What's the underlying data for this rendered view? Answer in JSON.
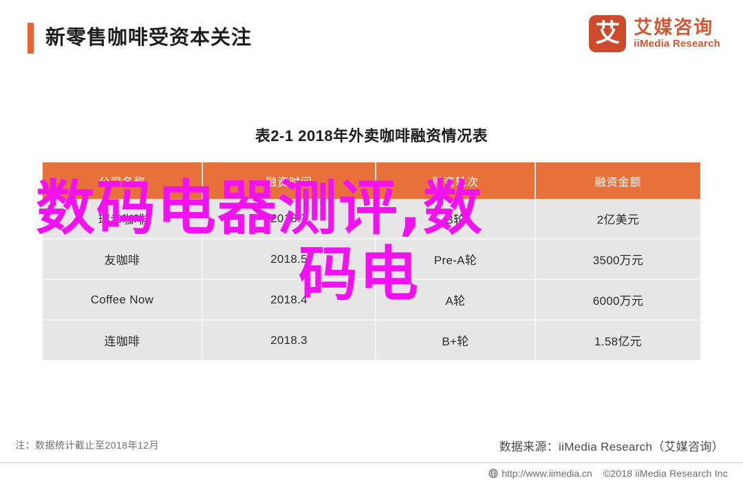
{
  "header": {
    "title": "新零售咖啡受资本关注",
    "accent_color": "#e8622f",
    "brand": {
      "mark_glyph": "艾",
      "mark_color": "#cd4a2d",
      "name_cn": "艾媒咨询",
      "name_en": "iiMedia Research",
      "text_color": "#d4552f"
    }
  },
  "chart_title": "表2-1 2018年外卖咖啡融资情况表",
  "watermark": {
    "line1": "数码电器测评,数",
    "line2": "码电",
    "color": "#f013f0"
  },
  "footer": {
    "note": "注：数据统计截止至2018年12月",
    "source": "数据来源：iiMedia Research（艾媒咨询）",
    "url": "http://www.iimedia.cn",
    "copyright": "©2018  iiMedia Research  Inc",
    "globe_icon": "globe-icon"
  },
  "chart_data": {
    "type": "table",
    "title": "表2-1 2018年外卖咖啡融资情况表",
    "xlabel": "",
    "ylabel": "",
    "header_bg": "#e8703a",
    "row_bg": "#e6e6e6",
    "columns": [
      "公司名称",
      "融资时间",
      "融资轮次",
      "融资金额"
    ],
    "rows": [
      [
        "瑞幸咖啡",
        "2018.7",
        "B轮",
        "2亿美元"
      ],
      [
        "友咖啡",
        "2018.5",
        "Pre-A轮",
        "3500万元"
      ],
      [
        "Coffee Now",
        "2018.4",
        "A轮",
        "6000万元"
      ],
      [
        "连咖啡",
        "2018.3",
        "B+轮",
        "1.58亿元"
      ]
    ]
  }
}
